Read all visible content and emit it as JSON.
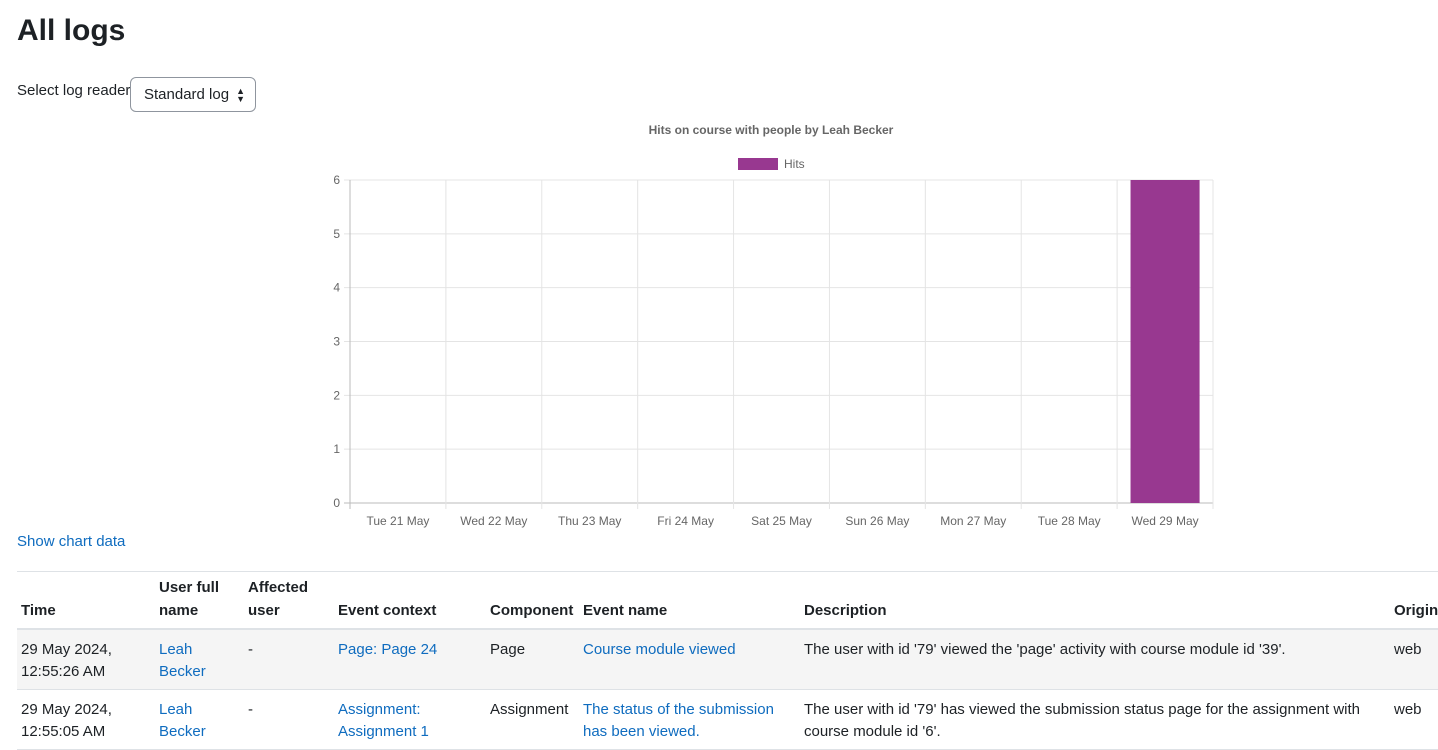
{
  "page": {
    "title": "All logs"
  },
  "log_reader": {
    "label": "Select log reader",
    "selected": "Standard log"
  },
  "chart_data": {
    "type": "bar",
    "title": "Hits on course with people by Leah Becker",
    "categories": [
      "Tue 21 May",
      "Wed 22 May",
      "Thu 23 May",
      "Fri 24 May",
      "Sat 25 May",
      "Sun 26 May",
      "Mon 27 May",
      "Tue 28 May",
      "Wed 29 May"
    ],
    "series": [
      {
        "name": "Hits",
        "values": [
          0,
          0,
          0,
          0,
          0,
          0,
          0,
          0,
          6
        ],
        "color": "#983890"
      }
    ],
    "yticks": [
      0,
      1,
      2,
      3,
      4,
      5,
      6
    ],
    "ylim": [
      0,
      6
    ],
    "grid": true,
    "legend": "top"
  },
  "chart_link": "Show chart data",
  "table": {
    "headers": [
      "Time",
      "User full name",
      "Affected user",
      "Event context",
      "Component",
      "Event name",
      "Description",
      "Origin"
    ],
    "rows": [
      {
        "time": "29 May 2024, 12:55:26 AM",
        "user": "Leah Becker",
        "affected": "-",
        "context": "Page: Page 24",
        "component": "Page",
        "event": "Course module viewed",
        "description": "The user with id '79' viewed the 'page' activity with course module id '39'.",
        "origin": "web"
      },
      {
        "time": "29 May 2024, 12:55:05 AM",
        "user": "Leah Becker",
        "affected": "-",
        "context": "Assignment: Assignment 1",
        "component": "Assignment",
        "event": "The status of the submission has been viewed.",
        "description": "The user with id '79' has viewed the submission status page for the assignment with course module id '6'.",
        "origin": "web"
      }
    ]
  }
}
